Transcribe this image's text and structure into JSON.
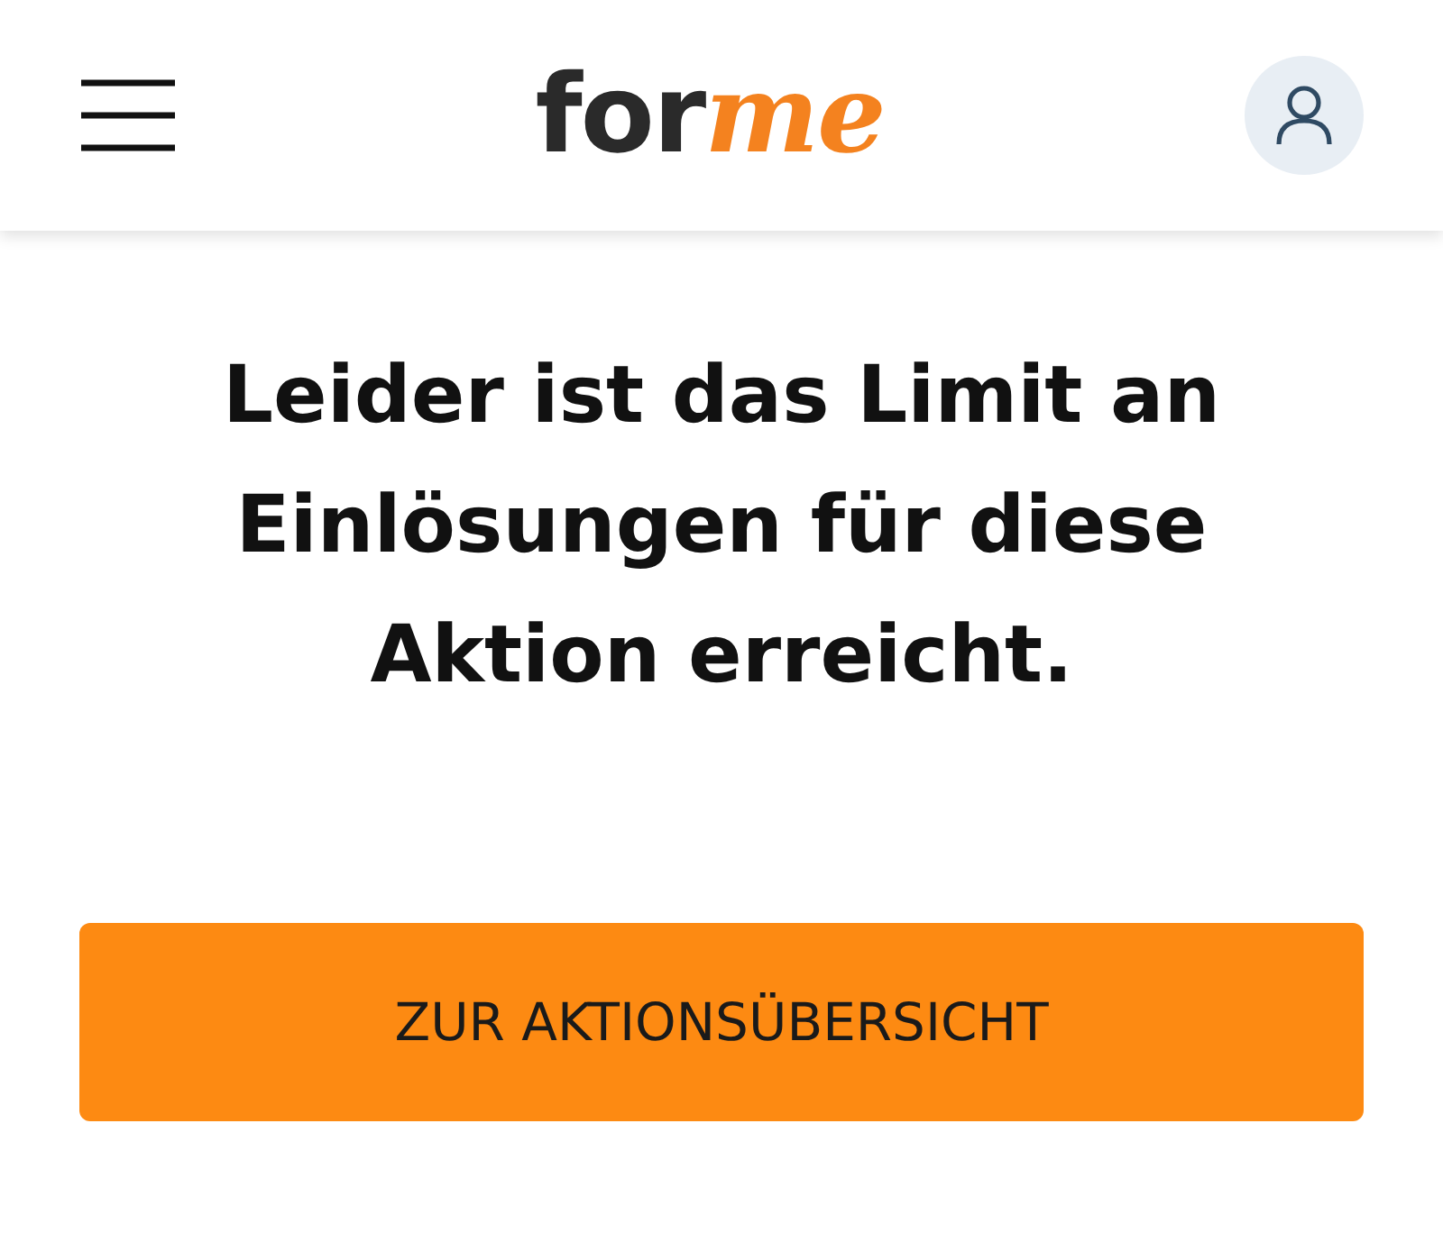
{
  "header": {
    "logo": {
      "text": "for",
      "accent": "me"
    }
  },
  "message": {
    "heading": "Leider ist das Limit an Einlösungen für diese Aktion erreicht."
  },
  "button": {
    "label": "ZUR AKTIONSÜBERSICHT"
  }
}
